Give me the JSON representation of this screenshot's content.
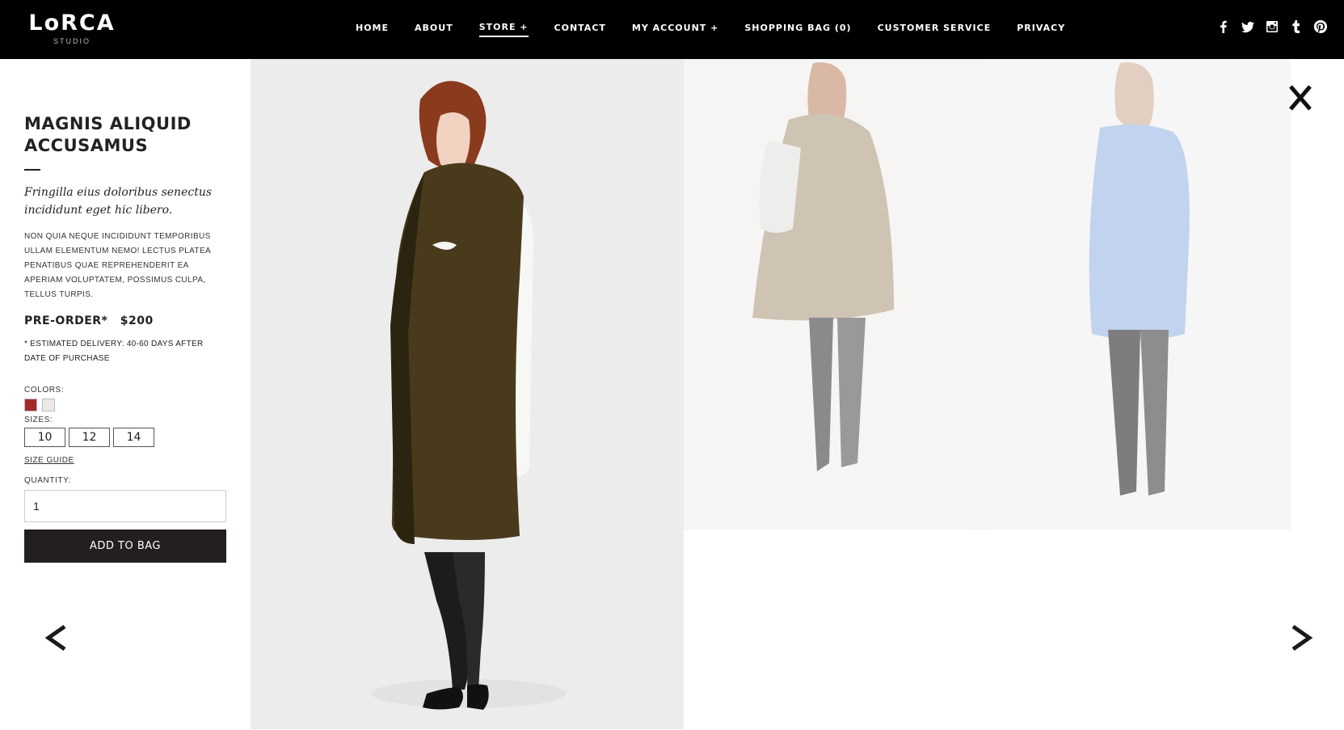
{
  "brand": {
    "name": "LoRCA",
    "sub": "STUDIO"
  },
  "nav": [
    {
      "label": "HOME"
    },
    {
      "label": "ABOUT"
    },
    {
      "label": "STORE +",
      "active": true
    },
    {
      "label": "CONTACT"
    },
    {
      "label": "MY ACCOUNT +"
    },
    {
      "label": "SHOPPING BAG (0)"
    },
    {
      "label": "CUSTOMER SERVICE"
    },
    {
      "label": "PRIVACY"
    }
  ],
  "social": [
    "facebook-icon",
    "twitter-icon",
    "instagram-icon",
    "tumblr-icon",
    "pinterest-icon"
  ],
  "product": {
    "title": "MAGNIS ALIQUID ACCUSAMUS",
    "subtitle": "Fringilla eius doloribus senectus incididunt eget hic libero.",
    "description": "NON QUIA NEQUE INCIDIDUNT TEMPORIBUS ULLAM ELEMENTUM NEMO! LECTUS PLATEA PENATIBUS QUAE REPREHENDERIT EA APERIAM VOLUPTATEM, POSSIMUS CULPA, TELLUS TURPIS.",
    "preorder": "PRE-ORDER*",
    "price": "$200",
    "delivery": "* ESTIMATED DELIVERY: 40-60 DAYS AFTER DATE OF PURCHASE",
    "colors_label": "COLORS:",
    "colors": [
      "#a32a2a",
      "#ece8e6"
    ],
    "sizes_label": "SIZES:",
    "sizes": [
      "10",
      "12",
      "14"
    ],
    "size_guide": "SIZE GUIDE",
    "quantity_label": "QUANTITY:",
    "quantity": "1",
    "add_to_bag": "ADD TO BAG"
  },
  "controls": {
    "close": "X"
  }
}
